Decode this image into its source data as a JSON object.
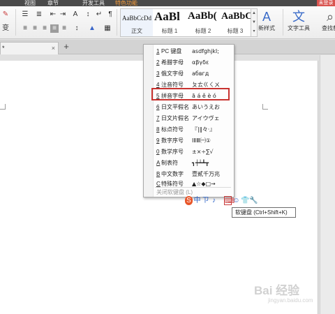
{
  "menubar": {
    "items": [
      "视图",
      "章节",
      "开发工具",
      "特色功能"
    ],
    "account": "未登录"
  },
  "ribbon": {
    "styles": [
      {
        "preview": "AaBbCcDd",
        "label": "正文"
      },
      {
        "preview": "AaBl",
        "label": "标题 1"
      },
      {
        "preview": "AaBb(",
        "label": "标题 2"
      },
      {
        "preview": "AaBbC",
        "label": "标题 3"
      }
    ],
    "new_style_label": "新样式",
    "text_tools_label": "文字工具",
    "find_replace_label": "查找替"
  },
  "tabs": {
    "doc_tab_label": "* ",
    "add_tab_glyph": "+"
  },
  "soft_keyboard_menu": {
    "items": [
      {
        "num": "1",
        "name": "PC 键盘",
        "sample": "asdfghjkl;"
      },
      {
        "num": "2",
        "name": "希腊字母",
        "sample": "αβγδε"
      },
      {
        "num": "3",
        "name": "俄文字母",
        "sample": "абвгд"
      },
      {
        "num": "4",
        "name": "注音符号",
        "sample": "ㄆㄊㄍㄑㄨ"
      },
      {
        "num": "5",
        "name": "拼音字母",
        "sample": "ā á ě è ó"
      },
      {
        "num": "6",
        "name": "日文平假名",
        "sample": "あいうえお"
      },
      {
        "num": "7",
        "name": "日文片假名",
        "sample": "アイウヴェ"
      },
      {
        "num": "8",
        "name": "标点符号",
        "sample": "『|‖々·』"
      },
      {
        "num": "9",
        "name": "数字序号",
        "sample": "ⅠⅡⅢ㈠①"
      },
      {
        "num": "0",
        "name": "数学序号",
        "sample": "±×÷∑√"
      },
      {
        "num": "A",
        "name": "制表符",
        "sample": "┓┿┷┻┳"
      },
      {
        "num": "B",
        "name": "中文数字",
        "sample": "壹貳千万兆"
      },
      {
        "num": "C",
        "name": "特殊符号",
        "sample": "▲☆◆□→"
      }
    ],
    "close_label": "关闭软键盘 (L)",
    "highlight_color": "#c8322f"
  },
  "ime_toolbar": {
    "icons": [
      "S",
      "中",
      "ㄗ",
      "♪",
      "⌨",
      "☺",
      "👕",
      "🔧"
    ]
  },
  "tooltip": {
    "text": "软键盘 (Ctrl+Shift+K)"
  },
  "watermark": {
    "text": "Bai 经验",
    "url": "jingyan.baidu.com"
  }
}
